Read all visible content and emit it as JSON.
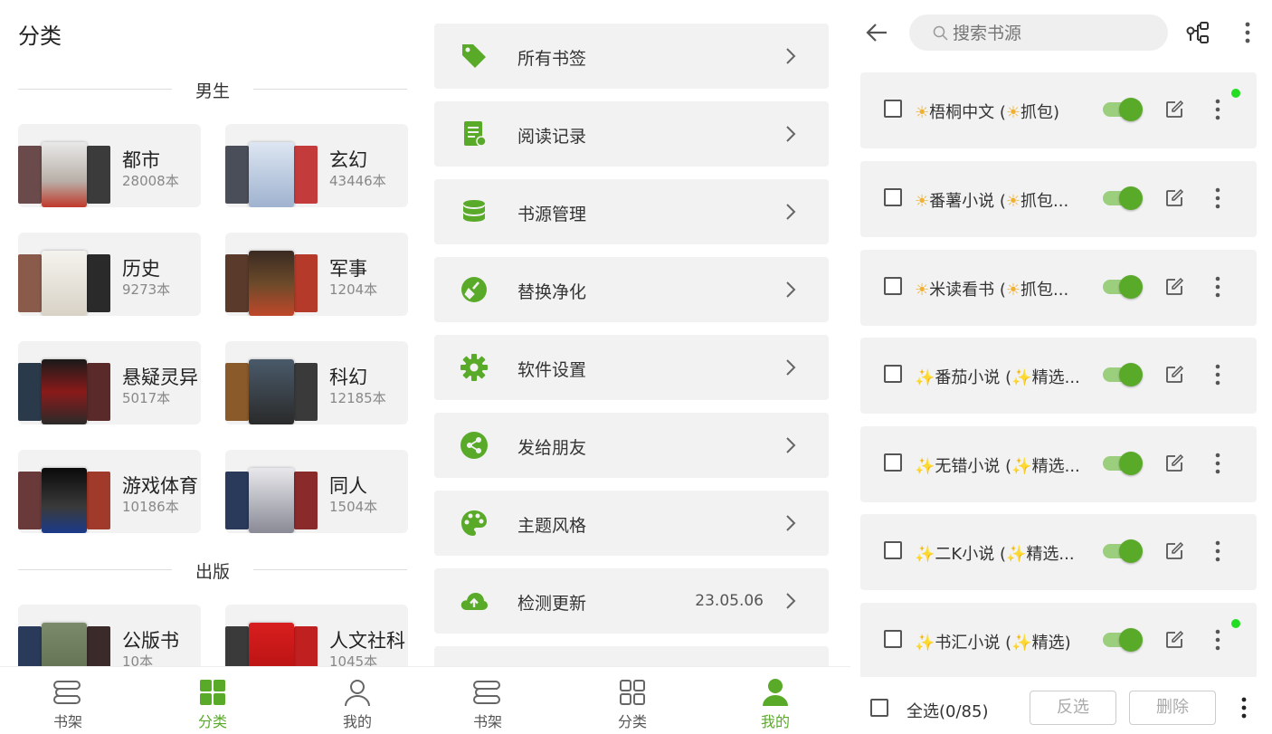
{
  "categories_screen": {
    "title": "分类",
    "sections": [
      {
        "header": "男生",
        "items": [
          {
            "name": "都市",
            "count": "28008本"
          },
          {
            "name": "玄幻",
            "count": "43446本"
          },
          {
            "name": "历史",
            "count": "9273本"
          },
          {
            "name": "军事",
            "count": "1204本"
          },
          {
            "name": "悬疑灵异",
            "count": "5017本"
          },
          {
            "name": "科幻",
            "count": "12185本"
          },
          {
            "name": "游戏体育",
            "count": "10186本"
          },
          {
            "name": "同人",
            "count": "1504本"
          }
        ]
      },
      {
        "header": "出版",
        "items": [
          {
            "name": "公版书",
            "count": "10本"
          },
          {
            "name": "人文社科",
            "count": "1045本"
          }
        ]
      }
    ],
    "nav": [
      {
        "label": "书架",
        "icon": "bookshelf-icon"
      },
      {
        "label": "分类",
        "icon": "category-grid-icon",
        "active": true
      },
      {
        "label": "我的",
        "icon": "person-icon"
      }
    ]
  },
  "mine_screen": {
    "menu": [
      {
        "label": "所有书签",
        "icon": "tag-icon"
      },
      {
        "label": "阅读记录",
        "icon": "reading-record-icon"
      },
      {
        "label": "书源管理",
        "icon": "database-icon"
      },
      {
        "label": "替换净化",
        "icon": "broom-icon"
      },
      {
        "label": "软件设置",
        "icon": "gear-icon"
      },
      {
        "label": "发给朋友",
        "icon": "share-icon"
      },
      {
        "label": "主题风格",
        "icon": "palette-icon"
      },
      {
        "label": "检测更新",
        "icon": "cloud-upload-icon",
        "value": "23.05.06"
      }
    ],
    "nav": [
      {
        "label": "书架",
        "icon": "bookshelf-icon"
      },
      {
        "label": "分类",
        "icon": "category-grid-icon"
      },
      {
        "label": "我的",
        "icon": "person-icon",
        "active": true
      }
    ]
  },
  "source_screen": {
    "search_placeholder": "搜索书源",
    "sources": [
      {
        "name": "梧桐中文 (",
        "tag": "抓包)",
        "dot": true
      },
      {
        "name": "番薯小说 (",
        "tag": "抓包...",
        "dot": false
      },
      {
        "name": "米读看书 (",
        "tag": "抓包...",
        "dot": false
      },
      {
        "name": "番茄小说 (",
        "tag": "精选...",
        "dot": false
      },
      {
        "name": "无错小说 (",
        "tag": "精选...",
        "dot": false
      },
      {
        "name": "二K小说 (",
        "tag": "精选...",
        "dot": false
      },
      {
        "name": "书汇小说 (",
        "tag": "精选)",
        "dot": true
      }
    ],
    "select_all_label": "全选(0/85)",
    "invert_label": "反选",
    "delete_label": "删除"
  },
  "colors": {
    "accent": "#5aaa2a",
    "card": "#f2f2f2",
    "toggle_track": "#9ccf7d",
    "online_dot": "#22dd22"
  }
}
